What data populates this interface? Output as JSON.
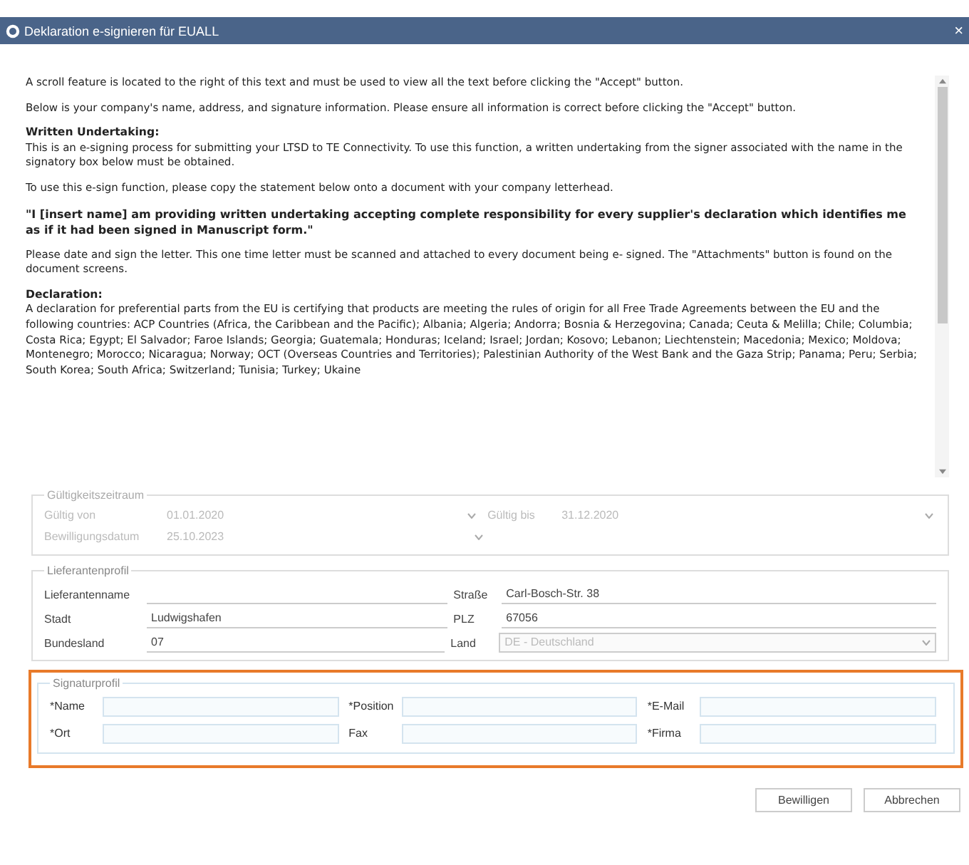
{
  "window": {
    "title": "Deklaration e-signieren für EUALL",
    "close": "×"
  },
  "notice": [
    {
      "kind": "plain",
      "text": "A scroll feature is located to the right of this text and must be used to view all the text before clicking the \"Accept\" button."
    },
    {
      "kind": "plain",
      "text": "Below is your company's name, address, and signature information. Please ensure all information is correct before clicking the \"Accept\" button."
    },
    {
      "kind": "plain",
      "heading": "Written Undertaking:",
      "text": "This is an e-signing process for submitting your LTSD to TE Connectivity. To use this function, a written undertaking from the signer associated with the name in the signatory box below must be obtained."
    },
    {
      "kind": "plain",
      "text": "To use this e-sign function, please copy the statement below onto a document with your company letterhead."
    },
    {
      "kind": "quote",
      "text": "\"I [insert name] am providing written undertaking accepting complete responsibility for every supplier's declaration which identifies me as if it had been signed in Manuscript form.\""
    },
    {
      "kind": "plain",
      "text": "Please date and sign the letter. This one time letter must be scanned and attached to every document being e- signed. The \"Attachments\" button is found on the document screens."
    },
    {
      "kind": "plain",
      "heading": "Declaration:",
      "text": "A declaration for preferential parts from the EU is certifying that products are meeting the rules of origin for all Free Trade Agreements between the EU and the following countries: ACP Countries (Africa, the Caribbean and the Pacific); Albania; Algeria; Andorra; Bosnia & Herzegovina; Canada; Ceuta & Melilla; Chile; Columbia; Costa Rica; Egypt; El Salvador; Faroe Islands; Georgia; Guatemala; Honduras; Iceland; Israel; Jordan; Kosovo; Lebanon; Liechtenstein; Macedonia; Mexico; Moldova; Montenegro; Morocco; Nicaragua; Norway; OCT (Overseas Countries and Territories); Palestinian Authority of the West Bank and the Gaza Strip; Panama; Peru; Serbia; South Korea; South Africa; Switzerland; Tunisia; Turkey; Ukaine"
    }
  ],
  "validity": {
    "legend": "Gültigkeitszeitraum",
    "disabled": true,
    "rows": [
      [
        {
          "label": "Gültig von",
          "value": "01.01.2020"
        },
        {
          "label": "Gültig bis",
          "value": "31.12.2020"
        }
      ],
      [
        {
          "label": "Bewilligungsdatum",
          "value": "25.10.2023"
        }
      ]
    ]
  },
  "supplier": {
    "legend": "Lieferantenprofil",
    "rows": [
      [
        {
          "kind": "text",
          "label": "Lieferantenname"
        },
        {
          "kind": "text",
          "label": "Straße",
          "value": "Carl-Bosch-Str. 38"
        }
      ],
      [
        {
          "kind": "text",
          "label": "Stadt",
          "value": "Ludwigshafen"
        },
        {
          "kind": "text",
          "label": "PLZ",
          "value": "67056"
        }
      ],
      [
        {
          "kind": "text",
          "label": "Bundesland",
          "value": "07"
        },
        {
          "kind": "select",
          "label": "Land",
          "value": "DE - Deutschland",
          "disabled": true
        }
      ]
    ]
  },
  "signature": {
    "legend": "Signaturprofil",
    "highlighted": true,
    "rows": [
      [
        {
          "label": "*Name"
        },
        {
          "label": "*Position"
        },
        {
          "label": "*E-Mail"
        }
      ],
      [
        {
          "label": "*Ort"
        },
        {
          "label": "Fax"
        },
        {
          "label": "*Firma"
        }
      ]
    ]
  },
  "buttons": [
    "Bewilligen",
    "Abbrechen"
  ]
}
